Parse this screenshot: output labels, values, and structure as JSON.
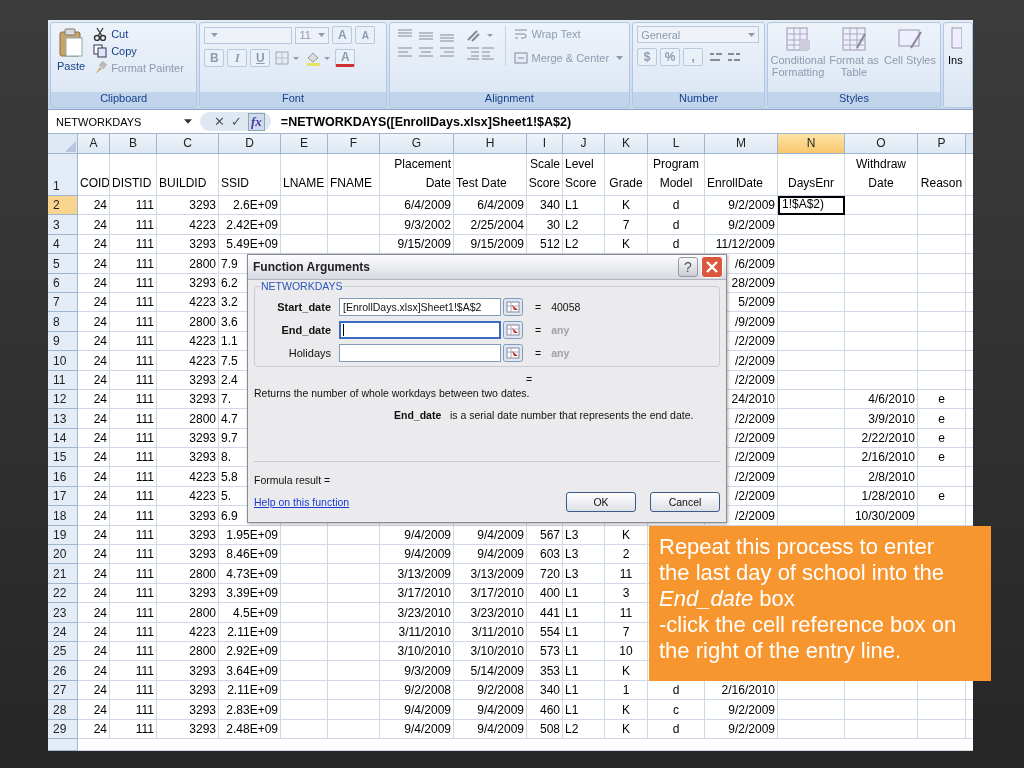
{
  "ribbon": {
    "clipboard": {
      "label": "Clipboard",
      "paste": "Paste",
      "cut": "Cut",
      "copy": "Copy",
      "format_painter": {
        "label": "Format Painter",
        "disabled": true
      }
    },
    "font": {
      "label": "Font",
      "disabled": true,
      "size": "11",
      "grow": "A",
      "shrink": "A",
      "bold": "B",
      "italic": "I",
      "underline": "U",
      "font_color": "A"
    },
    "alignment": {
      "label": "Alignment",
      "disabled": true,
      "wrap_text": "Wrap Text",
      "merge": "Merge & Center"
    },
    "number": {
      "label": "Number",
      "disabled": true,
      "format": "General",
      "currency": "$",
      "percent": "%",
      "comma": ","
    },
    "styles": {
      "label": "Styles",
      "disabled": true,
      "conditional": "Conditional Formatting",
      "table": "Format as Table",
      "cell": "Cell Styles"
    },
    "cells": {
      "insert": "Ins"
    }
  },
  "formula_bar": {
    "name_box": "NETWORKDAYS",
    "cancel": "✕",
    "enter": "✓",
    "fx": "fx",
    "formula": "=NETWORKDAYS([EnrollDays.xlsx]Sheet1!$A$2)"
  },
  "sheet": {
    "columns": [
      {
        "label": "A",
        "selected": false
      },
      {
        "label": "B",
        "selected": false
      },
      {
        "label": "C",
        "selected": false
      },
      {
        "label": "D",
        "selected": false
      },
      {
        "label": "E",
        "selected": false
      },
      {
        "label": "F",
        "selected": false
      },
      {
        "label": "G",
        "selected": false
      },
      {
        "label": "H",
        "selected": false
      },
      {
        "label": "I",
        "selected": false
      },
      {
        "label": "J",
        "selected": false
      },
      {
        "label": "K",
        "selected": false
      },
      {
        "label": "L",
        "selected": false
      },
      {
        "label": "M",
        "selected": false
      },
      {
        "label": "N",
        "selected": true
      },
      {
        "label": "O",
        "selected": false
      },
      {
        "label": "P",
        "selected": false
      }
    ],
    "rows": [
      {
        "number": "1",
        "selected": false,
        "cells": [
          "COID",
          "DISTID",
          "BUILDID",
          "SSID",
          "LNAME",
          "FNAME",
          "Placement Date",
          "Test Date",
          "Scale Score",
          "Level Score",
          "Grade",
          "Program Model",
          "EnrollDate",
          "DaysEnr",
          "Withdraw Date",
          "Reason"
        ]
      },
      {
        "number": "2",
        "selected": true,
        "cells": [
          "24",
          "111",
          "3293",
          "2.6E+09",
          null,
          null,
          "6/4/2009",
          "6/4/2009",
          "340",
          "L1",
          "K",
          "d",
          "9/2/2009",
          "1!$A$2)",
          null,
          null
        ]
      },
      {
        "number": "3",
        "selected": false,
        "cells": [
          "24",
          "111",
          "4223",
          "2.42E+09",
          null,
          null,
          "9/3/2002",
          "2/25/2004",
          "30",
          "L2",
          "7",
          "d",
          "9/2/2009",
          null,
          null,
          null
        ]
      },
      {
        "number": "4",
        "selected": false,
        "cells": [
          "24",
          "111",
          "3293",
          "5.49E+09",
          null,
          null,
          "9/15/2009",
          "9/15/2009",
          "512",
          "L2",
          "K",
          "d",
          "11/12/2009",
          null,
          null,
          null
        ]
      },
      {
        "number": "5",
        "selected": false,
        "cells": [
          "24",
          "111",
          "2800",
          "7.9",
          null,
          null,
          null,
          null,
          null,
          null,
          null,
          null,
          "/6/2009",
          null,
          null,
          null
        ]
      },
      {
        "number": "6",
        "selected": false,
        "cells": [
          "24",
          "111",
          "3293",
          "6.2",
          null,
          null,
          null,
          null,
          null,
          null,
          null,
          null,
          "28/2009",
          null,
          null,
          null
        ]
      },
      {
        "number": "7",
        "selected": false,
        "cells": [
          "24",
          "111",
          "4223",
          "3.2",
          null,
          null,
          null,
          null,
          null,
          null,
          null,
          null,
          "5/2009",
          null,
          null,
          null
        ]
      },
      {
        "number": "8",
        "selected": false,
        "cells": [
          "24",
          "111",
          "2800",
          "3.6",
          null,
          null,
          null,
          null,
          null,
          null,
          null,
          null,
          "/9/2009",
          null,
          null,
          null
        ]
      },
      {
        "number": "9",
        "selected": false,
        "cells": [
          "24",
          "111",
          "4223",
          "1.1",
          null,
          null,
          null,
          null,
          null,
          null,
          null,
          null,
          "/2/2009",
          null,
          null,
          null
        ]
      },
      {
        "number": "10",
        "selected": false,
        "cells": [
          "24",
          "111",
          "4223",
          "7.5",
          null,
          null,
          null,
          null,
          null,
          null,
          null,
          null,
          "/2/2009",
          null,
          null,
          null
        ]
      },
      {
        "number": "11",
        "selected": false,
        "cells": [
          "24",
          "111",
          "3293",
          "2.4",
          null,
          null,
          null,
          null,
          null,
          null,
          null,
          null,
          "/2/2009",
          null,
          null,
          null
        ]
      },
      {
        "number": "12",
        "selected": false,
        "cells": [
          "24",
          "111",
          "3293",
          "7.",
          null,
          null,
          null,
          null,
          null,
          null,
          null,
          null,
          "24/2010",
          null,
          "4/6/2010",
          "e"
        ]
      },
      {
        "number": "13",
        "selected": false,
        "cells": [
          "24",
          "111",
          "2800",
          "4.7",
          null,
          null,
          null,
          null,
          null,
          null,
          null,
          null,
          "/2/2009",
          null,
          "3/9/2010",
          "e"
        ]
      },
      {
        "number": "14",
        "selected": false,
        "cells": [
          "24",
          "111",
          "3293",
          "9.7",
          null,
          null,
          null,
          null,
          null,
          null,
          null,
          null,
          "/2/2009",
          null,
          "2/22/2010",
          "e"
        ]
      },
      {
        "number": "15",
        "selected": false,
        "cells": [
          "24",
          "111",
          "3293",
          "8.",
          null,
          null,
          null,
          null,
          null,
          null,
          null,
          null,
          "/2/2009",
          null,
          "2/16/2010",
          "e"
        ]
      },
      {
        "number": "16",
        "selected": false,
        "cells": [
          "24",
          "111",
          "4223",
          "5.8",
          null,
          null,
          null,
          null,
          null,
          null,
          null,
          null,
          "/2/2009",
          null,
          "2/8/2010",
          null
        ]
      },
      {
        "number": "17",
        "selected": false,
        "cells": [
          "24",
          "111",
          "4223",
          "5.",
          null,
          null,
          null,
          null,
          null,
          null,
          null,
          null,
          "/2/2009",
          null,
          "1/28/2010",
          "e"
        ]
      },
      {
        "number": "18",
        "selected": false,
        "cells": [
          "24",
          "111",
          "3293",
          "6.9",
          null,
          null,
          null,
          null,
          null,
          null,
          null,
          null,
          "/2/2009",
          null,
          "10/30/2009",
          null
        ]
      },
      {
        "number": "19",
        "selected": false,
        "cells": [
          "24",
          "111",
          "3293",
          "1.95E+09",
          null,
          null,
          "9/4/2009",
          "9/4/2009",
          "567",
          "L3",
          "K",
          null,
          null,
          null,
          null,
          null
        ]
      },
      {
        "number": "20",
        "selected": false,
        "cells": [
          "24",
          "111",
          "3293",
          "8.46E+09",
          null,
          null,
          "9/4/2009",
          "9/4/2009",
          "603",
          "L3",
          "2",
          null,
          null,
          null,
          null,
          null
        ]
      },
      {
        "number": "21",
        "selected": false,
        "cells": [
          "24",
          "111",
          "2800",
          "4.73E+09",
          null,
          null,
          "3/13/2009",
          "3/13/2009",
          "720",
          "L3",
          "11",
          null,
          null,
          null,
          null,
          null
        ]
      },
      {
        "number": "22",
        "selected": false,
        "cells": [
          "24",
          "111",
          "3293",
          "3.39E+09",
          null,
          null,
          "3/17/2010",
          "3/17/2010",
          "400",
          "L1",
          "3",
          null,
          null,
          null,
          null,
          null
        ]
      },
      {
        "number": "23",
        "selected": false,
        "cells": [
          "24",
          "111",
          "2800",
          "4.5E+09",
          null,
          null,
          "3/23/2010",
          "3/23/2010",
          "441",
          "L1",
          "11",
          null,
          null,
          null,
          null,
          null
        ]
      },
      {
        "number": "24",
        "selected": false,
        "cells": [
          "24",
          "111",
          "4223",
          "2.11E+09",
          null,
          null,
          "3/11/2010",
          "3/11/2010",
          "554",
          "L1",
          "7",
          null,
          null,
          null,
          null,
          null
        ]
      },
      {
        "number": "25",
        "selected": false,
        "cells": [
          "24",
          "111",
          "2800",
          "2.92E+09",
          null,
          null,
          "3/10/2010",
          "3/10/2010",
          "573",
          "L1",
          "10",
          null,
          null,
          null,
          null,
          null
        ]
      },
      {
        "number": "26",
        "selected": false,
        "cells": [
          "24",
          "111",
          "3293",
          "3.64E+09",
          null,
          null,
          "9/3/2009",
          "5/14/2009",
          "353",
          "L1",
          "K",
          null,
          null,
          null,
          null,
          null
        ]
      },
      {
        "number": "27",
        "selected": false,
        "cells": [
          "24",
          "111",
          "3293",
          "2.11E+09",
          null,
          null,
          "9/2/2008",
          "9/2/2008",
          "340",
          "L1",
          "1",
          "d",
          "2/16/2010",
          null,
          null,
          null
        ]
      },
      {
        "number": "28",
        "selected": false,
        "cells": [
          "24",
          "111",
          "3293",
          "2.83E+09",
          null,
          null,
          "9/4/2009",
          "9/4/2009",
          "460",
          "L1",
          "K",
          "c",
          "9/2/2009",
          null,
          null,
          null
        ]
      },
      {
        "number": "29",
        "selected": false,
        "cells": [
          "24",
          "111",
          "3293",
          "2.48E+09",
          null,
          null,
          "9/4/2009",
          "9/4/2009",
          "508",
          "L2",
          "K",
          "d",
          "9/2/2009",
          null,
          null,
          null
        ]
      }
    ]
  },
  "dialog": {
    "title": "Function Arguments",
    "help": "?",
    "function": "NETWORKDAYS",
    "arguments": [
      {
        "label": "Start_date",
        "required": true,
        "value": "[EnrollDays.xlsx]Sheet1!$A$2",
        "focused": false,
        "sign": "=",
        "result": "40058",
        "evaluated": true
      },
      {
        "label": "End_date",
        "required": true,
        "focused": true,
        "sign": "=",
        "result": "any",
        "evaluated": false
      },
      {
        "label": "Holidays",
        "required": false,
        "focused": false,
        "sign": "=",
        "result": "any",
        "evaluated": false
      }
    ],
    "function_sign": "=",
    "description": "Returns the number of whole workdays between two dates.",
    "argument_help": "**End_date**   is a serial date number that represents the end date.",
    "formula_result": "Formula result =",
    "help_link": "Help on this function",
    "buttons": [
      "OK",
      "Cancel"
    ]
  },
  "callout": {
    "paragraphs": [
      "Repeat this process to enter the last day of school into the *End_date* box",
      "-click the cell reference box on the right of the entry line."
    ]
  }
}
